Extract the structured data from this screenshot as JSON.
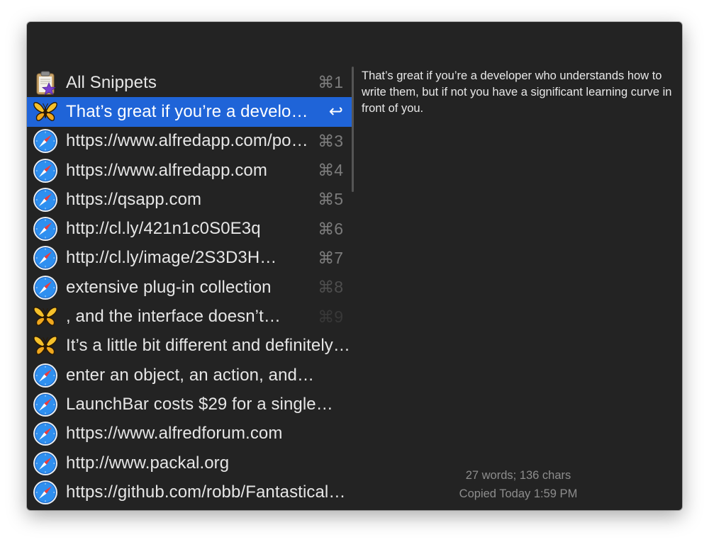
{
  "search": {
    "query": ""
  },
  "results": [
    {
      "icon": "clipboard-icon",
      "label": "All Snippets",
      "shortcut": "⌘1",
      "selected": false
    },
    {
      "icon": "butterfly-icon",
      "label": "That’s great if you’re a developer who understands how to write them, but if not you have a significant learning curve in front of you.",
      "shortcut": "↩",
      "selected": true
    },
    {
      "icon": "safari-icon",
      "label": "https://www.alfredapp.com/powerpack/",
      "shortcut": "⌘3",
      "selected": false
    },
    {
      "icon": "safari-icon",
      "label": "https://www.alfredapp.com",
      "shortcut": "⌘4",
      "selected": false
    },
    {
      "icon": "safari-icon",
      "label": "https://qsapp.com",
      "shortcut": "⌘5",
      "selected": false
    },
    {
      "icon": "safari-icon",
      "label": "http://cl.ly/421n1c0S0E3q",
      "shortcut": "⌘6",
      "selected": false
    },
    {
      "icon": "safari-icon",
      "label": "http://cl.ly/image/2S3D3H…",
      "shortcut": "⌘7",
      "selected": false
    },
    {
      "icon": "safari-icon",
      "label": "extensive plug-in collection",
      "shortcut": "⌘8",
      "selected": false
    },
    {
      "icon": "butterfly-icon",
      "label": ", and the interface doesn’t…",
      "shortcut": "⌘9",
      "selected": false
    },
    {
      "icon": "butterfly-icon",
      "label": "It’s a little bit different and definitely…",
      "shortcut": "",
      "selected": false
    },
    {
      "icon": "safari-icon",
      "label": "enter an object, an action, and…",
      "shortcut": "",
      "selected": false
    },
    {
      "icon": "safari-icon",
      "label": "LaunchBar costs $29 for a single…",
      "shortcut": "",
      "selected": false
    },
    {
      "icon": "safari-icon",
      "label": "https://www.alfredforum.com",
      "shortcut": "",
      "selected": false
    },
    {
      "icon": "safari-icon",
      "label": "http://www.packal.org",
      "shortcut": "",
      "selected": false
    },
    {
      "icon": "safari-icon",
      "label": "https://github.com/robb/FantasticalWorkflow",
      "shortcut": "",
      "selected": false
    }
  ],
  "preview": {
    "text": "That’s great if you’re a developer who understands how to write them, but if not you have a significant learning curve in front of you.",
    "stats": "27 words; 136 chars",
    "copied": "Copied Today 1:59 PM"
  },
  "colors": {
    "background": "#232323",
    "selection": "#1f64d8",
    "text": "#e6e6e6",
    "muted": "#8d8d8d"
  }
}
